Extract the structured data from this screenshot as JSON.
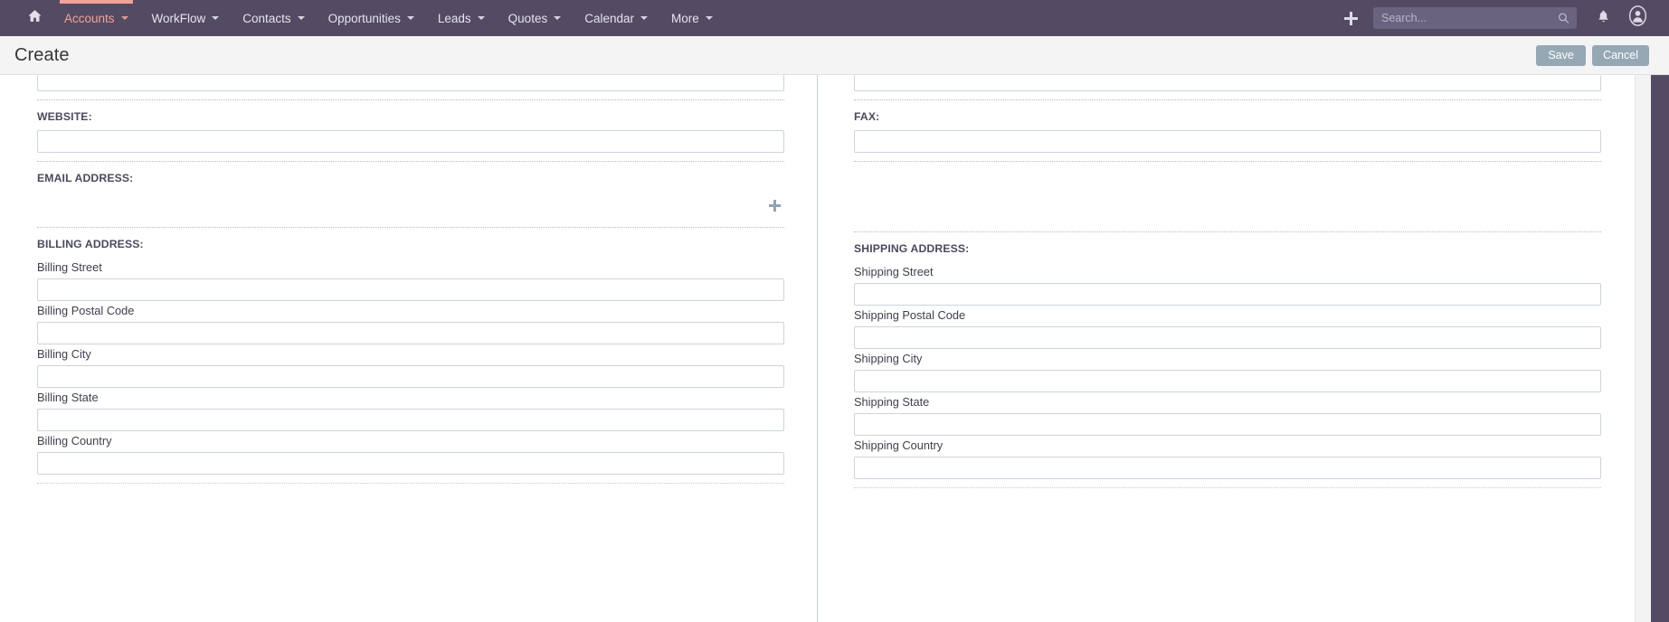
{
  "navbar": {
    "home_icon": "home-icon",
    "items": [
      {
        "label": "Accounts",
        "active": true,
        "has_caret": true
      },
      {
        "label": "WorkFlow",
        "active": false,
        "has_caret": true
      },
      {
        "label": "Contacts",
        "active": false,
        "has_caret": true
      },
      {
        "label": "Opportunities",
        "active": false,
        "has_caret": true
      },
      {
        "label": "Leads",
        "active": false,
        "has_caret": true
      },
      {
        "label": "Quotes",
        "active": false,
        "has_caret": true
      },
      {
        "label": "Calendar",
        "active": false,
        "has_caret": true
      },
      {
        "label": "More",
        "active": false,
        "has_caret": true
      }
    ],
    "quick_create_icon": "plus-icon",
    "search": {
      "placeholder": "Search...",
      "value": "",
      "icon": "search-icon"
    },
    "notifications_icon": "bell-icon",
    "profile_icon": "user-avatar-icon",
    "bg_color": "#534b63",
    "accent_color": "#f2a296"
  },
  "titlebar": {
    "title": "Create",
    "save_label": "Save",
    "cancel_label": "Cancel",
    "button_color": "#95a8b4"
  },
  "form": {
    "left_column": [
      {
        "type": "cutoff-input",
        "name": "top-partial-field",
        "value": ""
      },
      {
        "type": "field",
        "label": "WEBSITE:",
        "name": "website",
        "value": ""
      },
      {
        "type": "email",
        "label": "EMAIL ADDRESS:",
        "name": "email-address",
        "add_icon": "plus-icon"
      },
      {
        "type": "group",
        "label": "BILLING ADDRESS:",
        "name": "billing-address",
        "rows": [
          {
            "label": "Billing Street",
            "name": "billing-street",
            "value": ""
          },
          {
            "label": "Billing Postal Code",
            "name": "billing-postal-code",
            "value": ""
          },
          {
            "label": "Billing City",
            "name": "billing-city",
            "value": ""
          },
          {
            "label": "Billing State",
            "name": "billing-state",
            "value": ""
          },
          {
            "label": "Billing Country",
            "name": "billing-country",
            "value": ""
          }
        ]
      }
    ],
    "right_column": [
      {
        "type": "cutoff-input",
        "name": "top-partial-field-right",
        "value": ""
      },
      {
        "type": "field",
        "label": "FAX:",
        "name": "fax",
        "value": ""
      },
      {
        "type": "blank",
        "name": "email-address-spacer"
      },
      {
        "type": "group",
        "label": "SHIPPING ADDRESS:",
        "name": "shipping-address",
        "rows": [
          {
            "label": "Shipping Street",
            "name": "shipping-street",
            "value": ""
          },
          {
            "label": "Shipping Postal Code",
            "name": "shipping-postal-code",
            "value": ""
          },
          {
            "label": "Shipping City",
            "name": "shipping-city",
            "value": ""
          },
          {
            "label": "Shipping State",
            "name": "shipping-state",
            "value": ""
          },
          {
            "label": "Shipping Country",
            "name": "shipping-country",
            "value": ""
          }
        ]
      }
    ]
  }
}
